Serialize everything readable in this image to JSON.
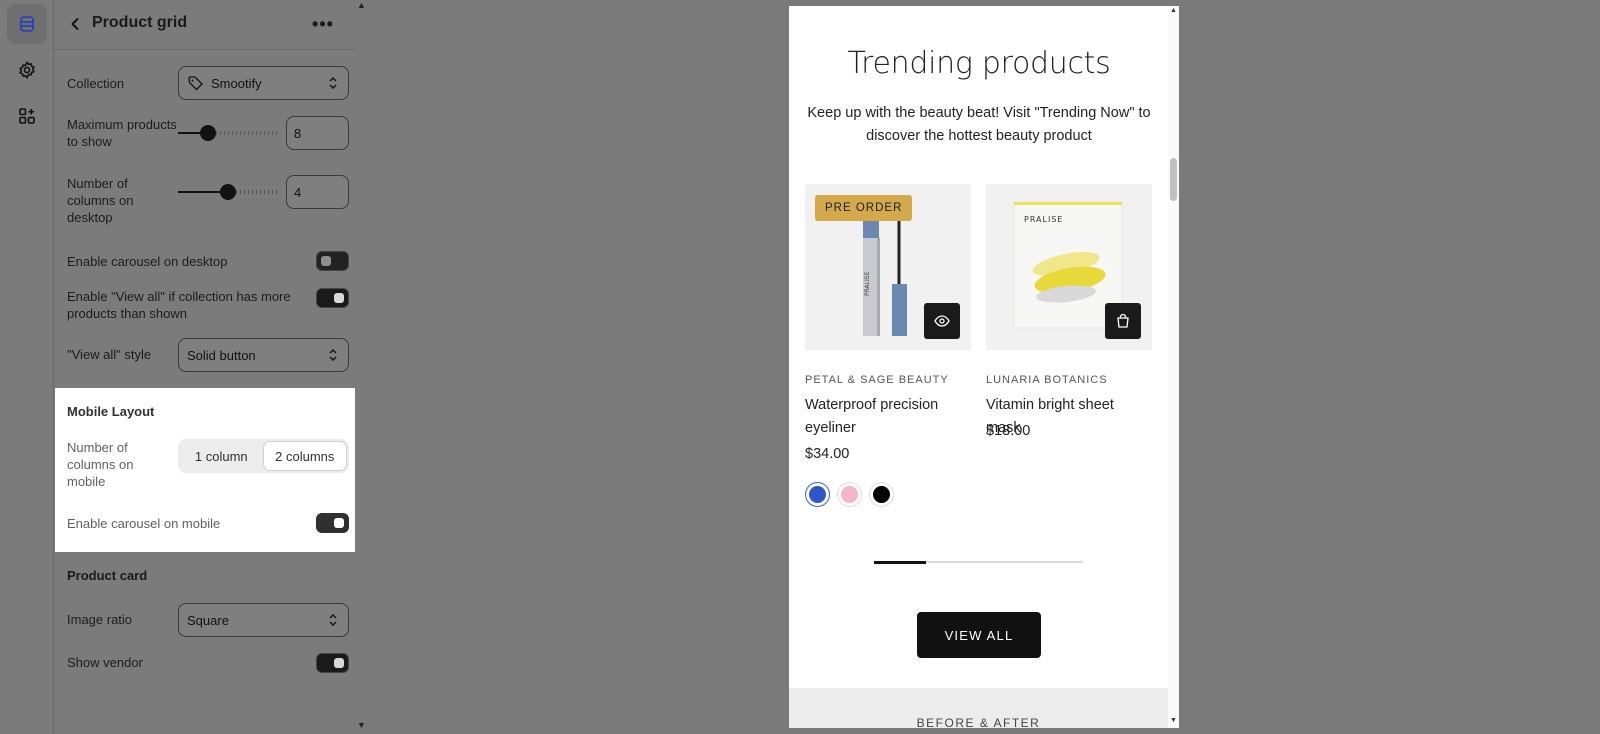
{
  "rail": {
    "icons": [
      "sections-icon",
      "settings-gear-icon",
      "apps-icon"
    ]
  },
  "panel": {
    "title": "Product grid",
    "more": "•••",
    "collection": {
      "label": "Collection",
      "value": "Smootify"
    },
    "max_products": {
      "label": "Maximum products to show",
      "value": "8",
      "slider_fraction": 0.3
    },
    "columns_desktop": {
      "label": "Number of columns on desktop",
      "value": "4",
      "slider_fraction": 0.5
    },
    "carousel_desktop": {
      "label": "Enable carousel on desktop",
      "on": false
    },
    "view_all_enable": {
      "label": "Enable \"View all\" if collection has more products than shown",
      "on": true
    },
    "view_all_style": {
      "label": "\"View all\" style",
      "value": "Solid button"
    },
    "mobile_layout": {
      "title": "Mobile Layout",
      "columns_label": "Number of columns on mobile",
      "options": [
        "1 column",
        "2 columns"
      ],
      "selected": "2 columns",
      "carousel_label": "Enable carousel on mobile",
      "carousel_on": true
    },
    "product_card": {
      "title": "Product card",
      "image_ratio": {
        "label": "Image ratio",
        "value": "Square"
      },
      "show_vendor": {
        "label": "Show vendor",
        "on": true
      }
    }
  },
  "preview": {
    "title": "Trending products",
    "description": "Keep up with the beauty beat! Visit \"Trending Now\" to discover the hottest beauty product",
    "products": [
      {
        "badge": "PRE ORDER",
        "vendor": "PETAL & SAGE BEAUTY",
        "name": "Waterproof precision eyeliner",
        "price": "$34.00",
        "action_icon": "eye-icon",
        "swatch_colors": [
          "#2f55c9",
          "#f4b6c6",
          "#000000"
        ]
      },
      {
        "badge": "",
        "vendor": "LUNARIA BOTANICS",
        "name": "Vitamin bright sheet mask",
        "price": "$18.00",
        "action_icon": "shopping-bag-icon",
        "image_text": "PRALISE"
      }
    ],
    "eyeliner_text": "PRALISE",
    "carousel_progress": 0.25,
    "view_all": "VIEW ALL",
    "next_section": "BEFORE & AFTER"
  }
}
